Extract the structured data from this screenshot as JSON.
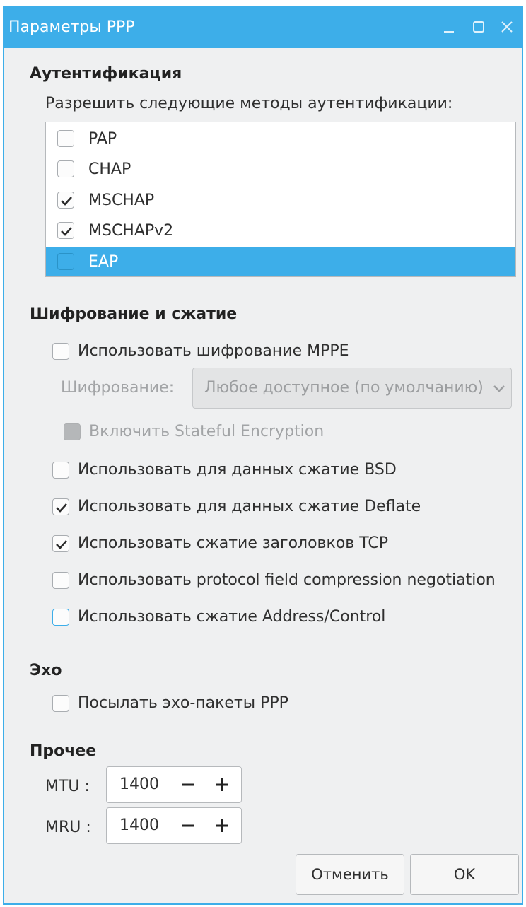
{
  "window": {
    "title": "Параметры PPP"
  },
  "auth": {
    "title": "Аутентификация",
    "subtitle": "Разрешить следующие методы аутентификации:",
    "methods": [
      {
        "label": "PAP",
        "checked": false
      },
      {
        "label": "CHAP",
        "checked": false
      },
      {
        "label": "MSCHAP",
        "checked": true
      },
      {
        "label": "MSCHAPv2",
        "checked": true
      },
      {
        "label": "EAP",
        "checked": false,
        "selected": true
      }
    ]
  },
  "encryption": {
    "title": "Шифрование и сжатие",
    "use_mppe": "Использовать шифрование MPPE",
    "cipher_label": "Шифрование:",
    "cipher_value": "Любое доступное (по умолчанию)",
    "stateful": "Включить Stateful Encryption",
    "bsd": "Использовать для данных сжатие BSD",
    "deflate": "Использовать для данных сжатие Deflate",
    "tcp_header": "Использовать сжатие заголовков TCP",
    "pfc": "Использовать protocol field compression negotiation",
    "addr_control": "Использовать сжатие Address/Control"
  },
  "echo": {
    "title": "Эхо",
    "send_echo": "Посылать эхо-пакеты PPP"
  },
  "other": {
    "title": "Прочее",
    "mtu_label": "MTU :",
    "mtu_value": "1400",
    "mru_label": "MRU :",
    "mru_value": "1400"
  },
  "buttons": {
    "cancel": "Отменить",
    "ok": "OK"
  },
  "colors": {
    "accent": "#3daee9",
    "window_bg": "#eff0f1"
  },
  "icons": [
    "minimize-icon",
    "maximize-icon",
    "close-icon",
    "checkmark-icon",
    "chevron-down-icon",
    "minus-icon",
    "plus-icon"
  ]
}
